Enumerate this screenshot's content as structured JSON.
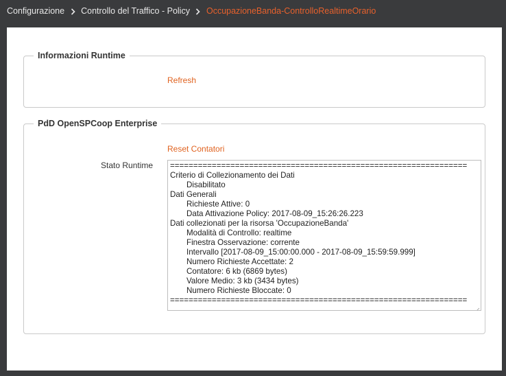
{
  "breadcrumb": {
    "items": [
      "Configurazione",
      "Controllo del Traffico - Policy",
      "OccupazioneBanda-ControlloRealtimeOrario"
    ]
  },
  "runtime_section": {
    "legend": "Informazioni Runtime",
    "refresh_label": "Refresh"
  },
  "pdd_section": {
    "legend": "PdD OpenSPCoop Enterprise",
    "reset_label": "Reset Contatori",
    "stato_label": "Stato Runtime",
    "stato_lines": [
      "================================================================",
      "Criterio di Collezionamento dei Dati",
      "\tDisabilitato",
      "Dati Generali",
      "\tRichieste Attive: 0",
      "\tData Attivazione Policy: 2017-08-09_15:26:26.223",
      "Dati collezionati per la risorsa 'OccupazioneBanda'",
      "\tModalità di Controllo: realtime",
      "\tFinestra Osservazione: corrente",
      "\tIntervallo [2017-08-09_15:00:00.000 - 2017-08-09_15:59:59.999]",
      "\tNumero Richieste Accettate: 2",
      "\tContatore: 6 kb (6869 bytes)",
      "\tValore Medio: 3 kb (3434 bytes)",
      "\tNumero Richieste Bloccate: 0",
      "================================================================"
    ]
  },
  "colors": {
    "accent": "#e8612c",
    "background": "#3a3b3d",
    "panel": "#ffffff"
  }
}
